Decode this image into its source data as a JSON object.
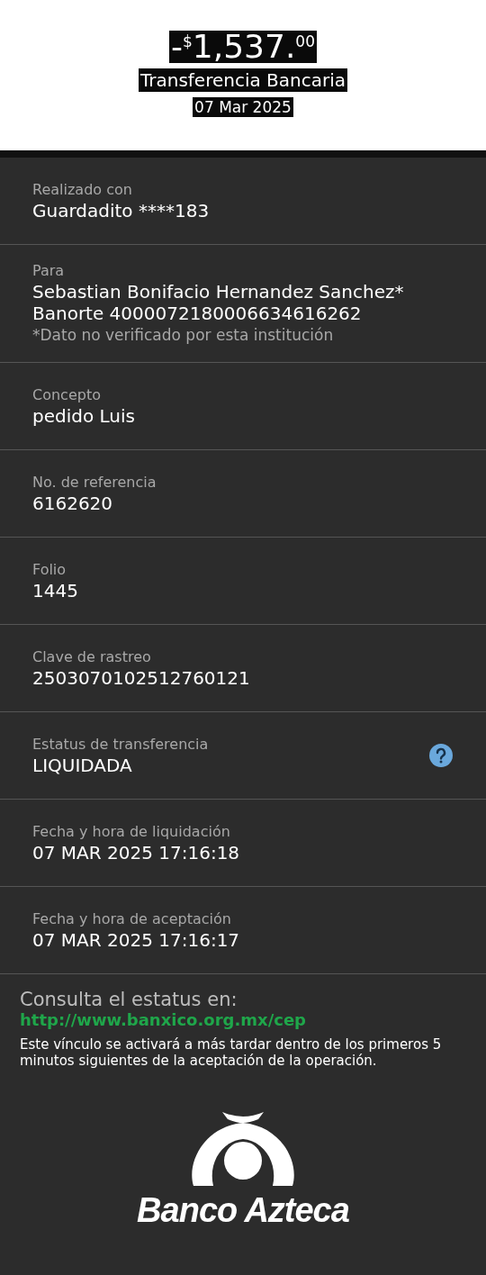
{
  "header": {
    "amount": {
      "sign": "-",
      "currency": "$",
      "whole": "1,537.",
      "cents": "00"
    },
    "title": "Transferencia Bancaria",
    "date": "07 Mar 2025"
  },
  "details": [
    {
      "label": "Realizado con",
      "values": [
        "Guardadito ****183"
      ],
      "help": false
    },
    {
      "label": "Para",
      "values": [
        "Sebastian Bonifacio Hernandez Sanchez*",
        "Banorte 4000072180006634616262"
      ],
      "note": "*Dato no verificado por esta institución",
      "help": false
    },
    {
      "label": "Concepto",
      "values": [
        "pedido Luis"
      ],
      "help": false
    },
    {
      "label": "No. de referencia",
      "values": [
        "6162620"
      ],
      "help": false
    },
    {
      "label": "Folio",
      "values": [
        "1445"
      ],
      "help": false
    },
    {
      "label": "Clave de rastreo",
      "values": [
        "2503070102512760121"
      ],
      "help": false
    },
    {
      "label": "Estatus de transferencia",
      "values": [
        "LIQUIDADA"
      ],
      "help": true
    },
    {
      "label": "Fecha y hora de liquidación",
      "values": [
        "07 MAR 2025 17:16:18"
      ],
      "help": false
    },
    {
      "label": "Fecha y hora de aceptación",
      "values": [
        "07 MAR 2025 17:16:17"
      ],
      "help": false
    }
  ],
  "footer": {
    "heading": "Consulta el estatus en:",
    "link": "http://www.banxico.org.mx/cep",
    "disclaimer": "Este vínculo se activará a más tardar dentro de los primeros 5 minutos siguientes de la aceptación de la operación.",
    "brand": "Banco Azteca"
  }
}
